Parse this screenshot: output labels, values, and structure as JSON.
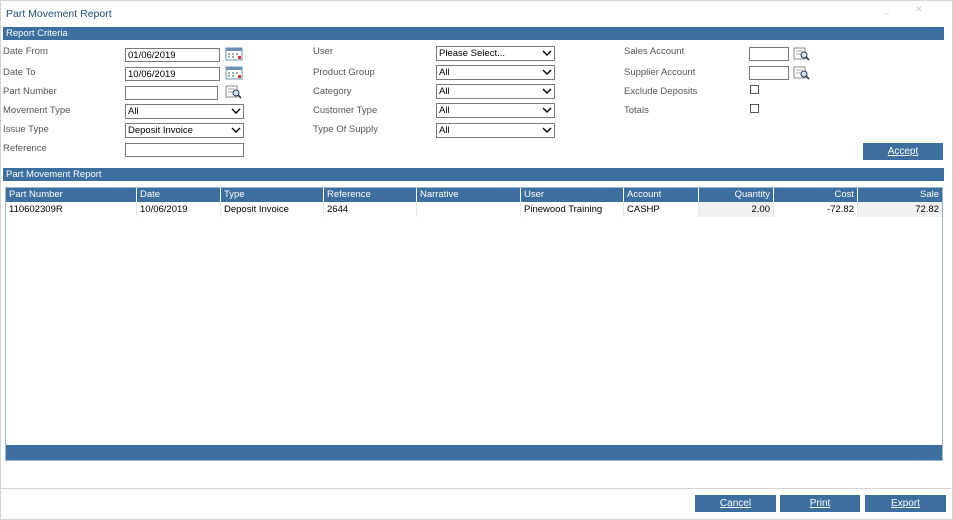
{
  "window": {
    "title": "Part Movement Report"
  },
  "criteria": {
    "section_title": "Report Criteria",
    "date_from_label": "Date From",
    "date_from_value": "01/06/2019",
    "date_to_label": "Date To",
    "date_to_value": "10/06/2019",
    "part_number_label": "Part Number",
    "part_number_value": "",
    "movement_type_label": "Movement Type",
    "movement_type_value": "All",
    "issue_type_label": "Issue Type",
    "issue_type_value": "Deposit Invoice",
    "reference_label": "Reference",
    "reference_value": "",
    "user_label": "User",
    "user_value": "Please Select...",
    "product_group_label": "Product Group",
    "product_group_value": "All",
    "category_label": "Category",
    "category_value": "All",
    "customer_type_label": "Customer Type",
    "customer_type_value": "All",
    "type_of_supply_label": "Type Of Supply",
    "type_of_supply_value": "All",
    "sales_account_label": "Sales Account",
    "sales_account_value": "",
    "supplier_account_label": "Supplier Account",
    "supplier_account_value": "",
    "exclude_deposits_label": "Exclude Deposits",
    "exclude_deposits_checked": false,
    "totals_label": "Totals",
    "totals_checked": false,
    "accept_label": "Accept"
  },
  "report": {
    "section_title": "Part Movement Report",
    "columns": [
      "Part Number",
      "Date",
      "Type",
      "Reference",
      "Narrative",
      "User",
      "Account",
      "Quantity",
      "Cost",
      "Sale"
    ],
    "rows": [
      [
        "110602309R",
        "10/06/2019",
        "Deposit Invoice",
        "2644",
        "",
        "Pinewood Training",
        "CASHP",
        "2.00",
        "-72.82",
        "72.82"
      ]
    ]
  },
  "footer": {
    "cancel_label": "Cancel",
    "print_label": "Print",
    "export_label": "Export"
  },
  "icons": {
    "calendar": "calendar-icon",
    "lookup": "lookup-icon",
    "dropdown": "chevron-down-icon"
  },
  "colors": {
    "accent": "#3c6e9f",
    "title": "#1f4e79"
  }
}
